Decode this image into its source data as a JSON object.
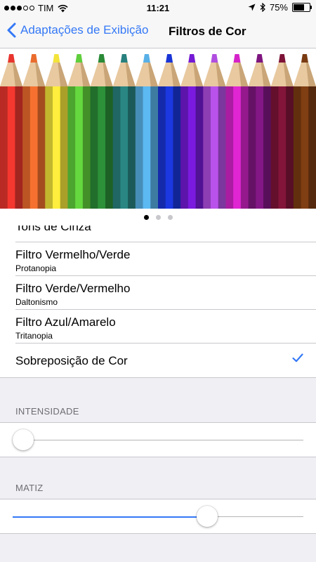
{
  "status_bar": {
    "signal_bars_filled": 3,
    "signal_bars_total": 5,
    "carrier": "TIM",
    "time": "11:21",
    "battery_percent": "75%",
    "battery_level": 0.75,
    "icons": [
      "wifi-icon",
      "location-arrow-icon",
      "bluetooth-icon",
      "battery-icon"
    ]
  },
  "nav": {
    "back_label": "Adaptações de Exibição",
    "title": "Filtros de Cor"
  },
  "colors": {
    "accent": "#3478f6"
  },
  "hero": {
    "page_count": 3,
    "active_page": 0,
    "pencil_colors": [
      "#e8352e",
      "#ea6c2d",
      "#f3e33a",
      "#5fce3b",
      "#2a8a36",
      "#27807d",
      "#58b0e6",
      "#1a35d6",
      "#7419d4",
      "#b04ee0",
      "#d523c9",
      "#7e1680",
      "#7d1437",
      "#7a3b12"
    ]
  },
  "filters": [
    {
      "title": "Tons de Cinza",
      "subtitle": "",
      "checked": false
    },
    {
      "title": "Filtro Vermelho/Verde",
      "subtitle": "Protanopia",
      "checked": false
    },
    {
      "title": "Filtro Verde/Vermelho",
      "subtitle": "Daltonismo",
      "checked": false
    },
    {
      "title": "Filtro Azul/Amarelo",
      "subtitle": "Tritanopia",
      "checked": false
    },
    {
      "title": "Sobreposição de Cor",
      "subtitle": "",
      "checked": true
    }
  ],
  "intensity": {
    "label": "INTENSIDADE",
    "value": 0.0
  },
  "hue": {
    "label": "MATIZ",
    "value": 0.67
  }
}
